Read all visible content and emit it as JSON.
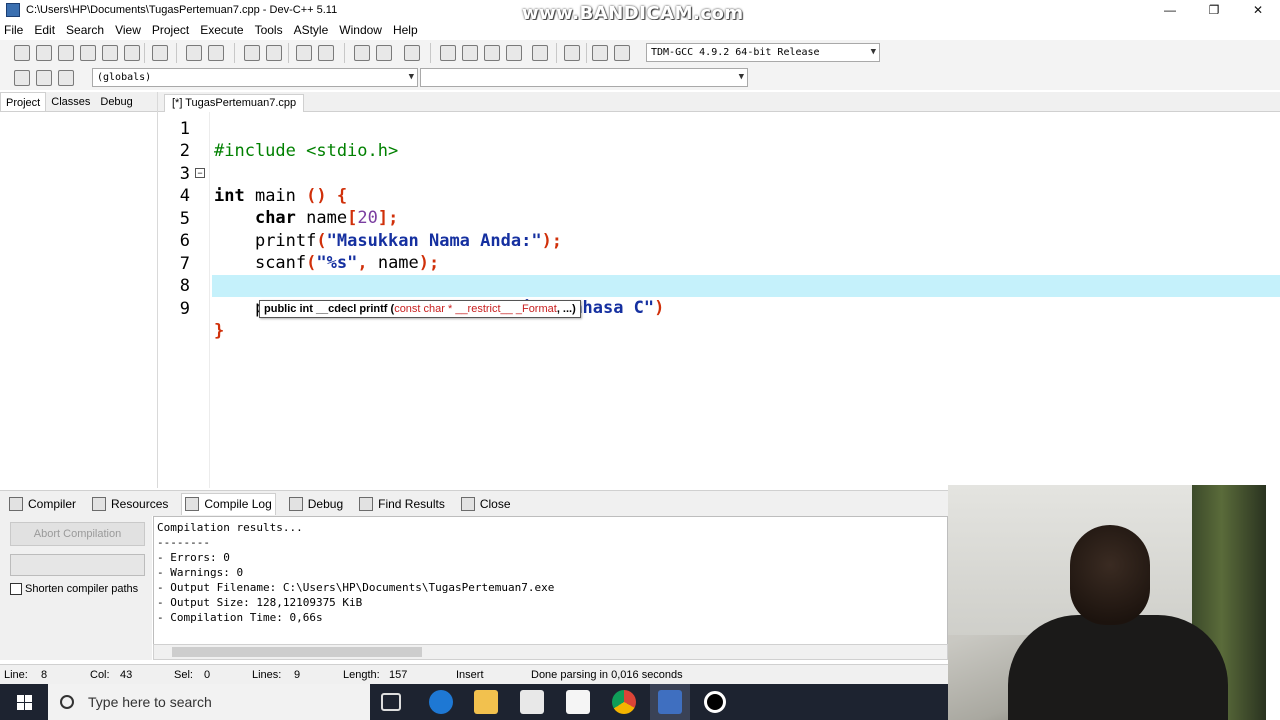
{
  "window": {
    "title": "C:\\Users\\HP\\Documents\\TugasPertemuan7.cpp - Dev-C++ 5.11",
    "watermark": "www.BANDICAM.com",
    "minimize": "—",
    "restore": "❐",
    "close": "✕"
  },
  "menu": [
    "File",
    "Edit",
    "Search",
    "View",
    "Project",
    "Execute",
    "Tools",
    "AStyle",
    "Window",
    "Help"
  ],
  "toolbar": {
    "compiler_select": "TDM-GCC 4.9.2 64-bit Release",
    "scope_select": "(globals)",
    "member_select": ""
  },
  "left_panel": {
    "tabs": [
      "Project",
      "Classes",
      "Debug"
    ],
    "active_tab": "Project"
  },
  "editor": {
    "file_tab": "[*] TugasPertemuan7.cpp",
    "line_numbers": [
      "1",
      "2",
      "3",
      "4",
      "5",
      "6",
      "7",
      "8",
      "9"
    ],
    "lines": {
      "l1": {
        "pp": "#include <stdio.h>"
      },
      "l3": {
        "kw": "int",
        "ident": " main ",
        "sym": "() {"
      },
      "l4": {
        "kw": "char",
        "ident": " name",
        "sym1": "[",
        "num": "20",
        "sym2": "];"
      },
      "l5": {
        "ident": "printf",
        "sym1": "(",
        "str": "\"Masukkan Nama Anda:\"",
        "sym2": ");"
      },
      "l6": {
        "ident": "scanf",
        "sym1": "(",
        "str": "\"%s\"",
        "sym2": ", ",
        "ident2": "name",
        "sym3": ");"
      },
      "l8": {
        "ident": "printf",
        "sym1": "(",
        "str": "\"Halo, selamat belajar bahasa C\"",
        "sym2": ")"
      },
      "l9": {
        "sym": "}"
      }
    },
    "fold_marker": "−",
    "calltip": {
      "prefix": "public int __cdecl printf (",
      "qualifier": "const char * __restrict__ _Format",
      "suffix": ", ...)"
    }
  },
  "bottom_tabs": [
    "Compiler",
    "Resources",
    "Compile Log",
    "Debug",
    "Find Results",
    "Close"
  ],
  "active_bottom_tab": "Compile Log",
  "compile_panel": {
    "abort_button": "Abort Compilation",
    "shorten_paths_label": "Shorten compiler paths",
    "shorten_paths_checked": false,
    "log": "Compilation results...\n--------\n- Errors: 0\n- Warnings: 0\n- Output Filename: C:\\Users\\HP\\Documents\\TugasPertemuan7.exe\n- Output Size: 128,12109375 KiB\n- Compilation Time: 0,66s"
  },
  "statusbar": {
    "line_label": "Line:",
    "line_value": "8",
    "col_label": "Col:",
    "col_value": "43",
    "sel_label": "Sel:",
    "sel_value": "0",
    "lines_label": "Lines:",
    "lines_value": "9",
    "length_label": "Length:",
    "length_value": "157",
    "mode": "Insert",
    "message": "Done parsing in 0,016 seconds"
  },
  "taskbar": {
    "search_placeholder": "Type here to search",
    "apps": [
      "task-view",
      "edge",
      "file-explorer",
      "store",
      "mail",
      "chrome",
      "dev-cpp",
      "bandicam-record"
    ]
  },
  "colors": {
    "current_line": "#c5f1fb",
    "preprocessor": "#008000",
    "string": "#1530a0",
    "symbol": "#d0300a",
    "number": "#7a3ea0",
    "taskbar": "#1d2330"
  }
}
